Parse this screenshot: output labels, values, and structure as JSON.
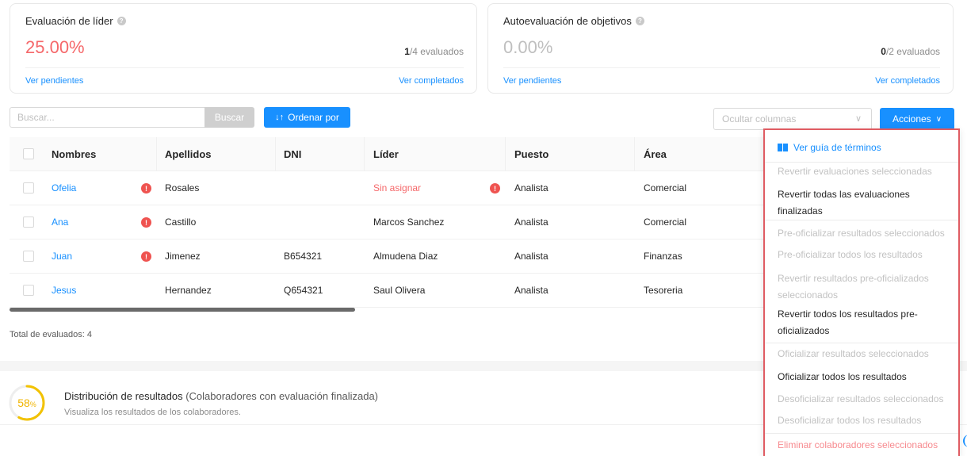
{
  "cards": [
    {
      "title": "Evaluación de líder",
      "pct": "25.00%",
      "pct_color": "#f5686a",
      "count_done": "1",
      "count_total": "/4 evaluados",
      "link_left": "Ver pendientes",
      "link_right": "Ver completados"
    },
    {
      "title": "Autoevaluación de objetivos",
      "pct": "0.00%",
      "pct_color": "#bfbfbf",
      "count_done": "0",
      "count_total": "/2 evaluados",
      "link_left": "Ver pendientes",
      "link_right": "Ver completados"
    }
  ],
  "toolbar": {
    "search_placeholder": "Buscar...",
    "search_button": "Buscar",
    "order_button": "Ordenar por",
    "hide_columns_placeholder": "Ocultar columnas",
    "actions_button": "Acciones"
  },
  "table": {
    "headers": [
      "Nombres",
      "Apellidos",
      "DNI",
      "Líder",
      "Puesto",
      "Área"
    ],
    "rows": [
      {
        "nombre": "Ofelia",
        "apellido": "Rosales",
        "dni": "",
        "lider": "Sin asignar",
        "puesto": "Analista",
        "area": "Comercial"
      },
      {
        "nombre": "Ana",
        "apellido": "Castillo",
        "dni": "",
        "lider": "Marcos Sanchez",
        "puesto": "Analista",
        "area": "Comercial"
      },
      {
        "nombre": "Juan",
        "apellido": "Jimenez",
        "dni": "B654321",
        "lider": "Almudena Diaz",
        "puesto": "Analista",
        "area": "Finanzas"
      },
      {
        "nombre": "Jesus",
        "apellido": "Hernandez",
        "dni": "Q654321",
        "lider": "Saul Olivera",
        "puesto": "Analista",
        "area": "Tesoreria"
      }
    ],
    "total_label": "Total de evaluados: 4"
  },
  "distribution": {
    "percent": "58",
    "percent_sign": "%",
    "percent_value": 58,
    "title": "Distribución de resultados",
    "title_suffix": " (Colaboradores con evaluación finalizada)",
    "subtitle": "Visualiza los resultados de los colaboradores."
  },
  "menu": {
    "items": [
      "Ver guía de términos",
      "Revertir evaluaciones seleccionadas",
      "Revertir todas las evaluaciones finalizadas",
      "Pre-oficializar resultados seleccionados",
      "Pre-oficializar todos los resultados",
      "Revertir resultados pre-oficializados seleccionados",
      "Revertir todos los resultados pre-oficializados",
      "Oficializar resultados seleccionados",
      "Oficializar todos los resultados",
      "Desoficializar resultados seleccionados",
      "Desoficializar todos los resultados",
      "Eliminar colaboradores seleccionados"
    ]
  }
}
